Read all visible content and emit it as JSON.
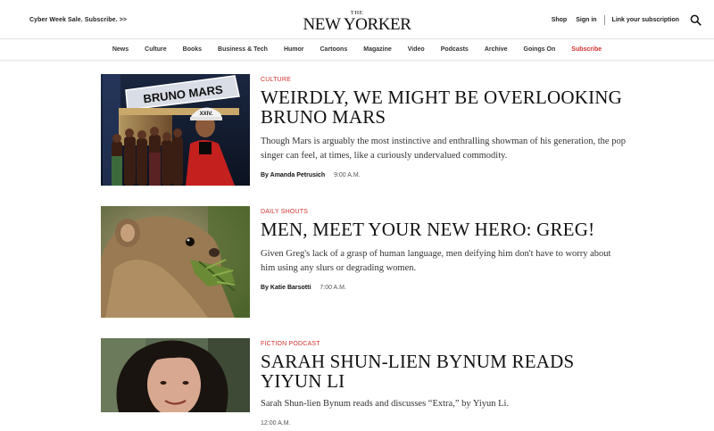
{
  "header": {
    "promo": "Cyber Week Sale. Subscribe. >>",
    "logo_the": "THE",
    "logo_name": "NEW YORKER",
    "shop": "Shop",
    "sign_in": "Sign in",
    "subscription_link": "Link your subscription",
    "search_icon": "search-icon"
  },
  "nav": {
    "items": [
      "News",
      "Culture",
      "Books",
      "Business & Tech",
      "Humor",
      "Cartoons",
      "Magazine",
      "Video",
      "Podcasts",
      "Archive",
      "Goings On",
      "Subscribe"
    ],
    "accent_color": "#d0312d"
  },
  "articles": [
    {
      "rubric": "Culture",
      "headline": "Weirdly, We Might Be Overlooking Bruno Mars",
      "dek": "Though Mars is arguably the most instinctive and enthralling showman of his generation, the pop singer can feel, at times, like a curiously undervalued commodity.",
      "author": "By Amanda Petrusich",
      "time": "9:00 A.M.",
      "image_text": "BRUNO MARS",
      "hat_text": "XXIV."
    },
    {
      "rubric": "Daily Shouts",
      "headline": "Men, Meet Your New Hero: Greg!",
      "dek": "Given Greg's lack of a grasp of human language, men deifying him don't have to worry about him using any slurs or degrading women.",
      "author": "By Katie Barsotti",
      "time": "7:00 A.M."
    },
    {
      "rubric": "Fiction Podcast",
      "headline": "Sarah Shun-lien Bynum Reads Yiyun Li",
      "dek": "Sarah Shun-lien Bynum reads and discusses “Extra,” by Yiyun Li.",
      "author": "",
      "time": "12:00 A.M."
    }
  ]
}
